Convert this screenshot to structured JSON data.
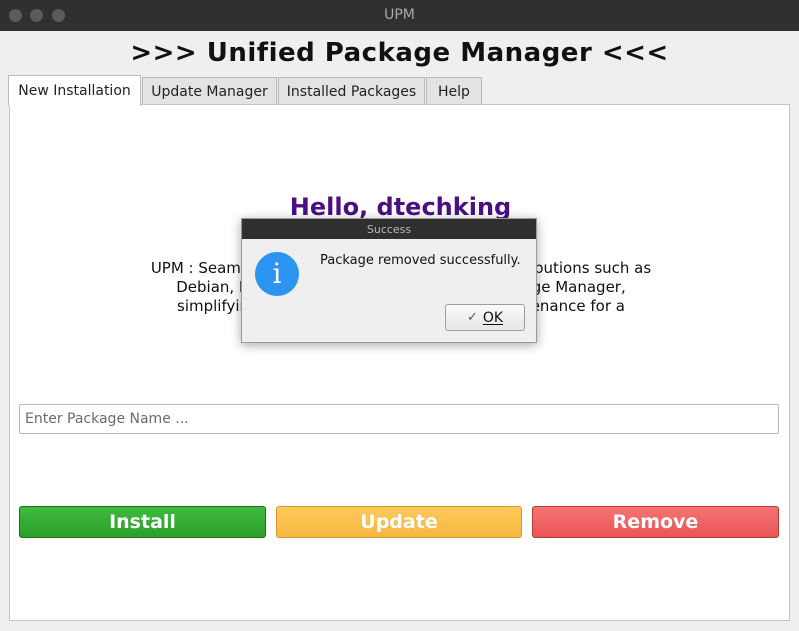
{
  "window": {
    "title": "UPM"
  },
  "header": {
    "title": ">>> Unified Package Manager <<<"
  },
  "tabs": [
    {
      "label": "New Installation",
      "active": true
    },
    {
      "label": "Update Manager",
      "active": false
    },
    {
      "label": "Installed Packages",
      "active": false
    },
    {
      "label": "Help",
      "active": false
    }
  ],
  "main": {
    "greeting": "Hello, dtechking",
    "description_lines": [
      "UPM : Seamless",
      "stributions such as",
      "Debian, Fedor",
      "ckage Manager,",
      "simplifying s",
      "intenance for a"
    ],
    "package_input": {
      "placeholder": "Enter Package Name ...",
      "value": ""
    },
    "buttons": {
      "install": "Install",
      "update": "Update",
      "remove": "Remove"
    }
  },
  "dialog": {
    "title": "Success",
    "message": "Package removed successfully.",
    "icon": "info-icon",
    "ok_label": "OK"
  },
  "colors": {
    "greeting": "#4b0f82",
    "install": "#2fa62f",
    "update": "#f8bd47",
    "remove": "#ee5c5c",
    "info_icon": "#2a94f0"
  }
}
